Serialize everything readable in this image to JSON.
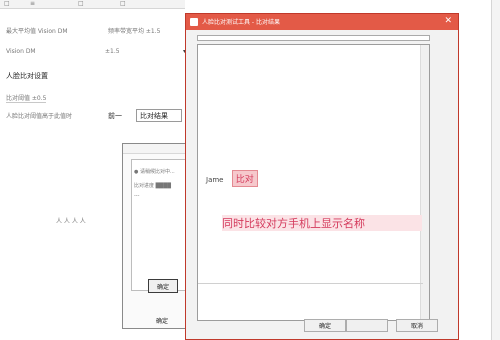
{
  "background": {
    "menu_strip": [
      "□",
      "≡",
      "□",
      "□"
    ],
    "settings_row1": [
      "最大平均值 Vision DM",
      "频率带宽平均 ±1.5"
    ],
    "settings_row2": [
      "Vision DM",
      "±1.5"
    ],
    "section_title": "人脸比对设置",
    "setting_label": "比对阈值 ±0.5",
    "setting_sub": "人脸比对阈值高于此值时",
    "chip_label": "前一",
    "chip_value": "比对结果",
    "side_label": "人 人 人 人",
    "dialog2_text": [
      "● 请稍候比对中...",
      "比对进度 ████",
      "---"
    ],
    "dialog2_ok": "确定",
    "dialog2_tab": "确定"
  },
  "dialog": {
    "title": "人脸比对测试工具 - 比对结果",
    "close_symbol": "✕",
    "result_label": "Jame",
    "result_value": "比对",
    "message": "同时比较对方手机上显示名称",
    "buttons": {
      "confirm": "确定",
      "middle": "",
      "cancel": "取消"
    }
  },
  "colors": {
    "accent": "#e35a47",
    "highlight": "#f6c8cc",
    "message_text": "#d43a5c"
  }
}
